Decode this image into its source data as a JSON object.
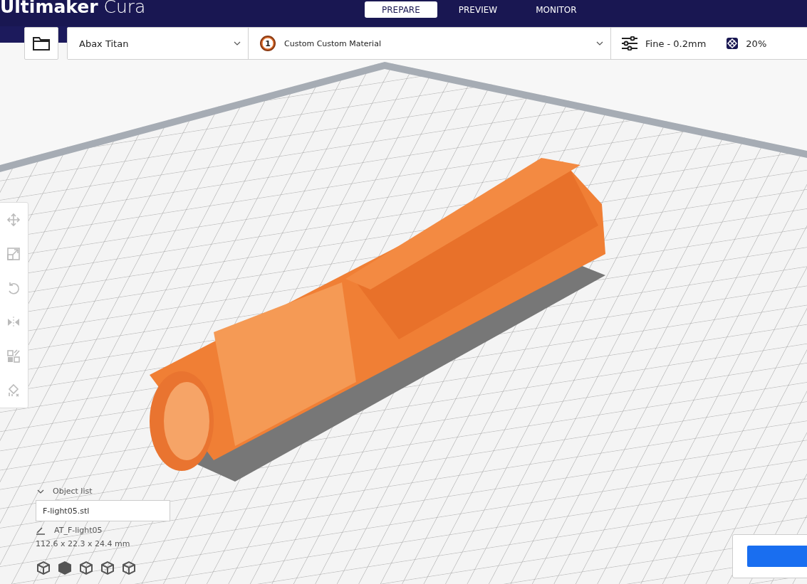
{
  "app": {
    "brand": "Ultimaker",
    "product": "Cura"
  },
  "stages": [
    {
      "label": "PREPARE",
      "selected": true
    },
    {
      "label": "PREVIEW",
      "selected": false
    },
    {
      "label": "MONITOR",
      "selected": false
    }
  ],
  "toolbar": {
    "printer": "Abax Titan",
    "extruder": "1",
    "material": "Custom Custom Material",
    "profile": "Fine - 0.2mm",
    "infill": "20%"
  },
  "object_list": {
    "heading": "Object list",
    "expanded": true,
    "file": "F-light05.stl",
    "object_name": "AT_F-light05",
    "dimensions": "112.6 x 22.3 x 24.4 mm"
  }
}
